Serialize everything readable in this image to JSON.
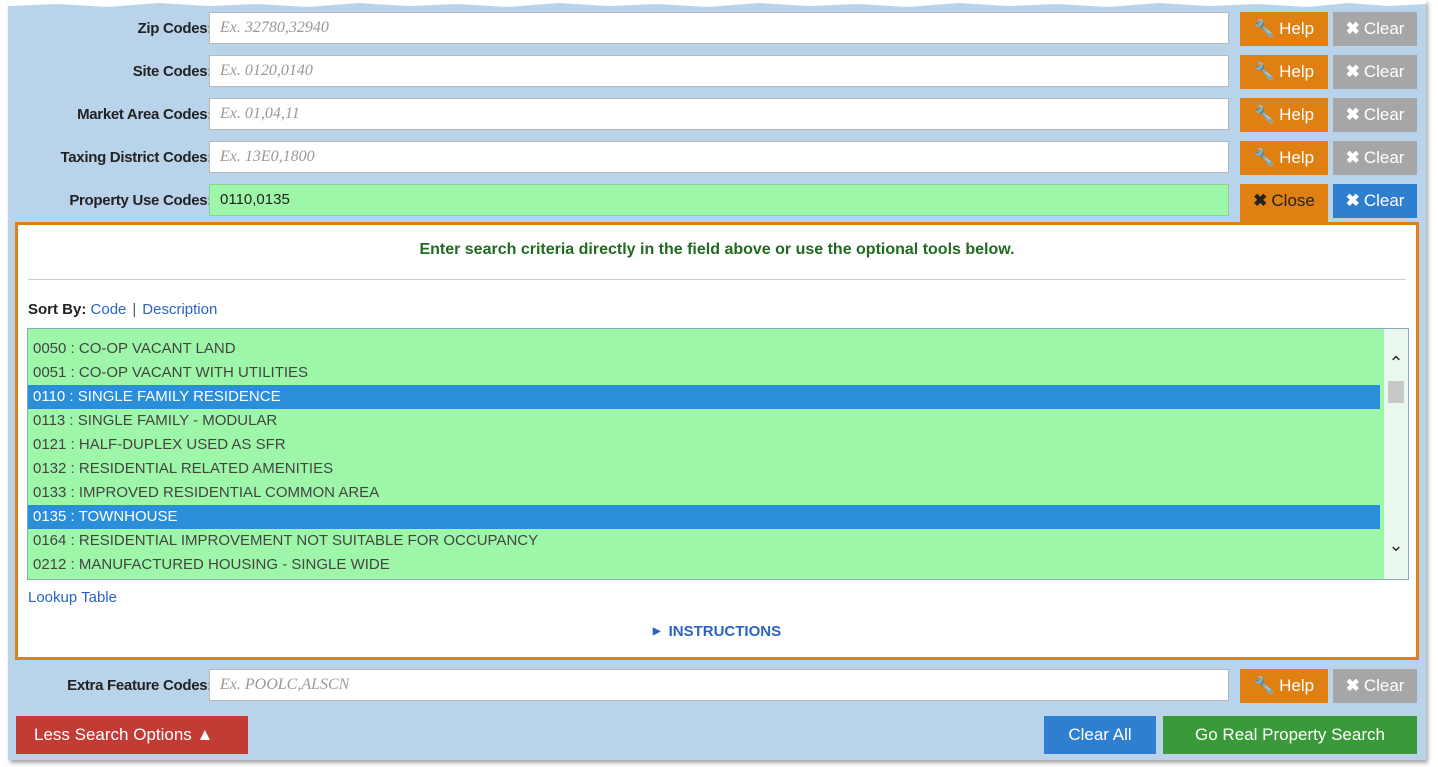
{
  "fields": [
    {
      "label": "Zip Codes:",
      "placeholder": "Ex. 32780,32940",
      "value": ""
    },
    {
      "label": "Site Codes:",
      "placeholder": "Ex. 0120,0140",
      "value": ""
    },
    {
      "label": "Market Area Codes:",
      "placeholder": "Ex. 01,04,11",
      "value": ""
    },
    {
      "label": "Taxing District Codes:",
      "placeholder": "Ex. 13E0,1800",
      "value": ""
    },
    {
      "label": "Property Use Codes:",
      "placeholder": "",
      "value": "0110,0135"
    }
  ],
  "extra_field": {
    "label": "Extra Feature Codes:",
    "placeholder": "Ex. POOLC,ALSCN"
  },
  "buttons": {
    "help": "Help",
    "clear": "Clear",
    "close": "Close",
    "less_options": "Less Search Options",
    "clear_all": "Clear All",
    "go_search": "Go Real Property Search"
  },
  "tools": {
    "hint": "Enter search criteria directly in the field above or use the optional tools below.",
    "sort_by_label": "Sort By:",
    "sort_code": "Code",
    "sort_sep": "|",
    "sort_description": "Description",
    "lookup_link": "Lookup Table",
    "instructions": "INSTRUCTIONS"
  },
  "codes": [
    {
      "text": "0050 : CO-OP VACANT LAND",
      "selected": false
    },
    {
      "text": "0051 : CO-OP VACANT WITH UTILITIES",
      "selected": false
    },
    {
      "text": "0110 : SINGLE FAMILY RESIDENCE",
      "selected": true
    },
    {
      "text": "0113 : SINGLE FAMILY - MODULAR",
      "selected": false
    },
    {
      "text": "0121 : HALF-DUPLEX USED AS SFR",
      "selected": false
    },
    {
      "text": "0132 : RESIDENTIAL RELATED AMENITIES",
      "selected": false
    },
    {
      "text": "0133 : IMPROVED RESIDENTIAL COMMON AREA",
      "selected": false
    },
    {
      "text": "0135 : TOWNHOUSE",
      "selected": true
    },
    {
      "text": "0164 : RESIDENTIAL IMPROVEMENT NOT SUITABLE FOR OCCUPANCY",
      "selected": false
    },
    {
      "text": "0212 : MANUFACTURED HOUSING - SINGLE WIDE",
      "selected": false
    }
  ],
  "colors": {
    "help": "#e07f12",
    "clear_inactive": "#a6a6a6",
    "clear_active": "#2f7fd0",
    "selected_row": "#2a8fd8",
    "list_bg": "#9ef7a8",
    "less_options": "#c23b34",
    "go_search": "#3a9a3a"
  },
  "icons": {
    "help": "wrench-icon",
    "clear": "x-icon",
    "close": "x-icon",
    "less": "caret-up-icon",
    "instructions": "caret-right-icon"
  }
}
